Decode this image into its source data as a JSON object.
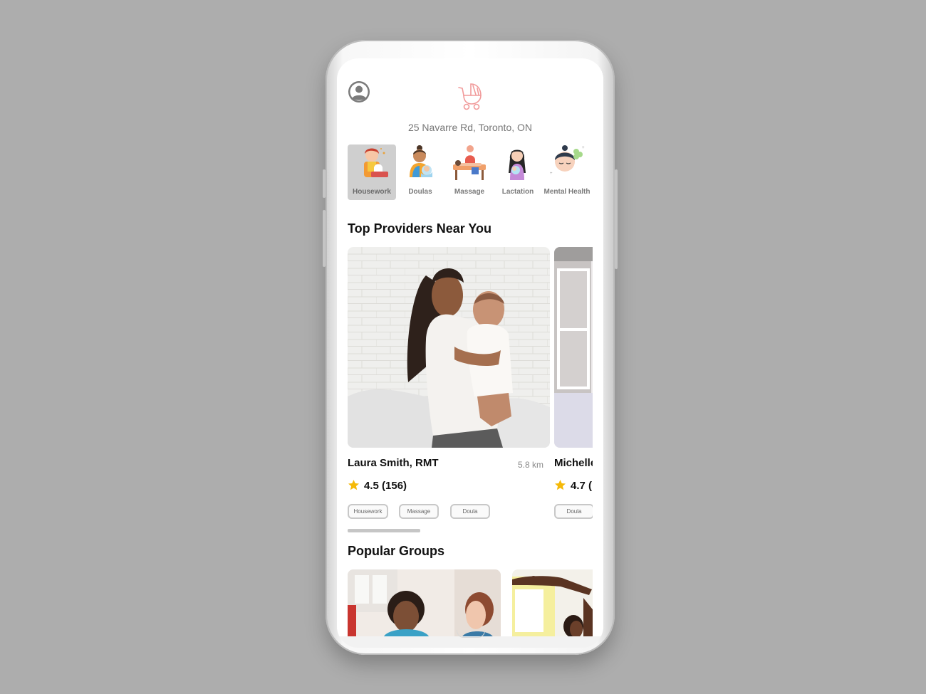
{
  "app": {
    "address": "25 Navarre Rd, Toronto, ON",
    "logo_icon": "baby-stroller-icon",
    "profile_icon": "user-avatar-icon",
    "accent_color": "#f19a9a"
  },
  "categories": [
    {
      "label": "Housework",
      "icon": "housework-icon",
      "active": true
    },
    {
      "label": "Doulas",
      "icon": "doula-icon",
      "active": false
    },
    {
      "label": "Massage",
      "icon": "massage-icon",
      "active": false
    },
    {
      "label": "Lactation",
      "icon": "lactation-icon",
      "active": false
    },
    {
      "label": "Mental Health",
      "icon": "mental-health-icon",
      "active": false
    }
  ],
  "providers_section": {
    "title": "Top Providers Near You",
    "providers": [
      {
        "name": "Laura Smith, RMT",
        "distance": "5.8 km",
        "rating": "4.5 (156)",
        "tags": [
          "Housework",
          "Massage",
          "Doula"
        ]
      },
      {
        "name": "Michelle",
        "rating": "4.7 (",
        "tags": [
          "Doula"
        ]
      }
    ]
  },
  "groups_section": {
    "title": "Popular Groups"
  }
}
